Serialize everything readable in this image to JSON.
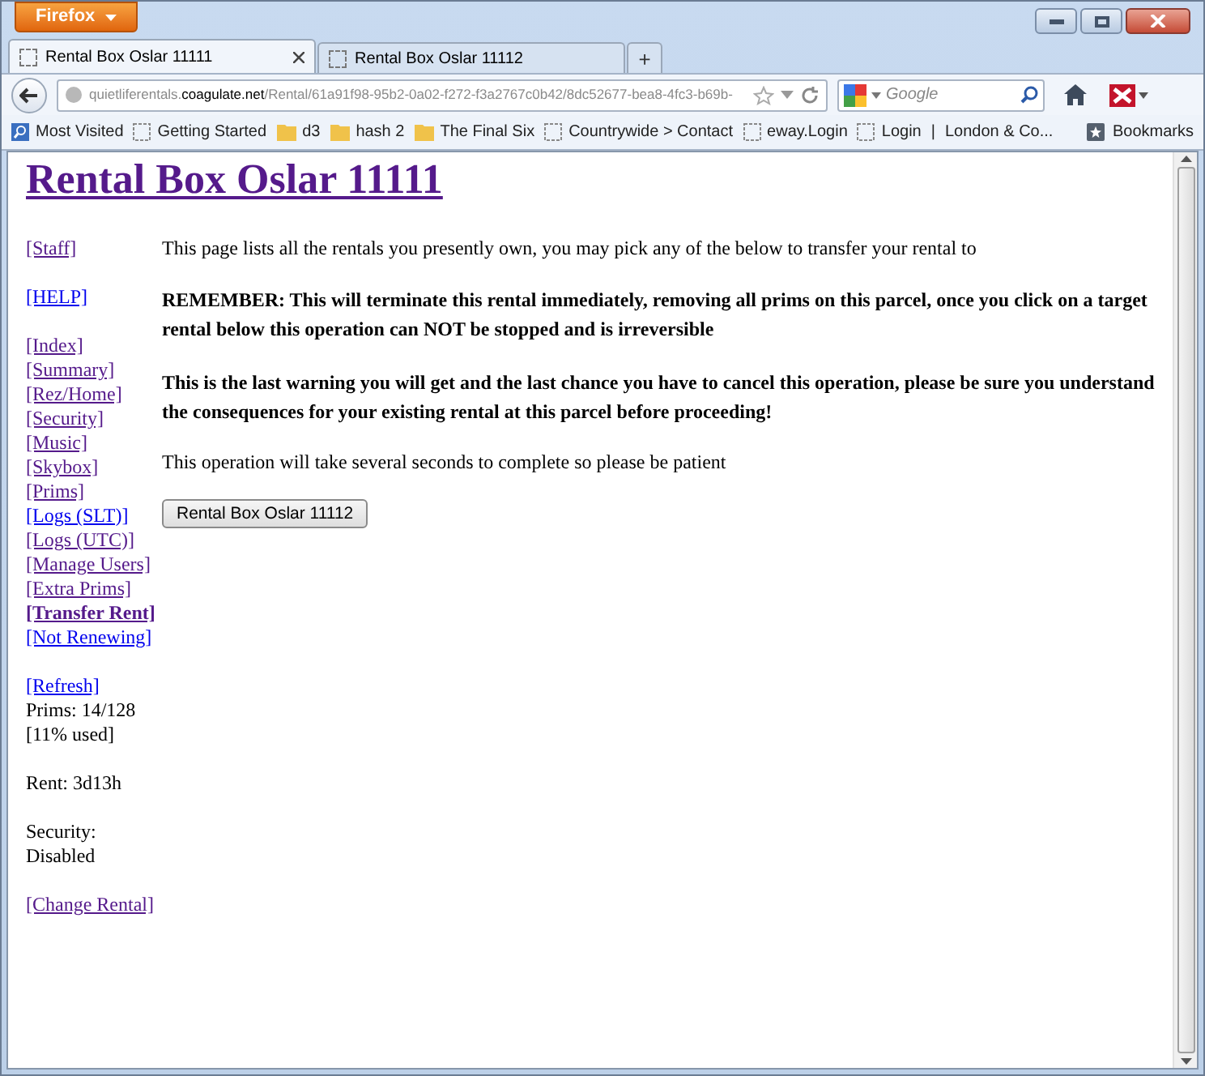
{
  "browser": {
    "menu_button": "Firefox",
    "tabs": [
      {
        "label": "Rental Box Oslar 11111",
        "selected": true
      },
      {
        "label": "Rental Box Oslar 11112",
        "selected": false
      }
    ],
    "new_tab": "+",
    "address": {
      "prefix": "quietliferentals.",
      "domain": "coagulate.net",
      "path": "/Rental/61a91f98-95b2-0a02-f272-f3a2767c0b42/8dc52677-bea8-4fc3-b69b-"
    },
    "search": {
      "placeholder": "Google"
    },
    "bookmarks": [
      {
        "label": "Most Visited",
        "kind": "special"
      },
      {
        "label": "Getting Started",
        "kind": "page"
      },
      {
        "label": "d3",
        "kind": "folder"
      },
      {
        "label": "hash 2",
        "kind": "folder"
      },
      {
        "label": "The Final Six",
        "kind": "folder"
      },
      {
        "label": "Countrywide > Contact",
        "kind": "page"
      },
      {
        "label": "eway.Login",
        "kind": "page"
      },
      {
        "label": "Login",
        "kind": "page"
      },
      {
        "label": "|",
        "kind": "separator"
      },
      {
        "label": "London & Co...",
        "kind": "plain"
      }
    ],
    "bookmarks_menu": "Bookmarks"
  },
  "page": {
    "title": "Rental Box Oslar 11111",
    "sidebar": [
      [
        {
          "label": "[Staff]",
          "kind": "link",
          "visited": true,
          "current": false
        }
      ],
      [
        {
          "label": "[HELP]",
          "kind": "link",
          "visited": false,
          "current": false
        }
      ],
      [
        {
          "label": "[Index]",
          "kind": "link",
          "visited": true,
          "current": false
        },
        {
          "label": "[Summary]",
          "kind": "link",
          "visited": true,
          "current": false
        },
        {
          "label": "[Rez/Home]",
          "kind": "link",
          "visited": true,
          "current": false
        },
        {
          "label": "[Security]",
          "kind": "link",
          "visited": true,
          "current": false
        },
        {
          "label": "[Music]",
          "kind": "link",
          "visited": true,
          "current": false
        },
        {
          "label": "[Skybox]",
          "kind": "link",
          "visited": true,
          "current": false
        },
        {
          "label": "[Prims]",
          "kind": "link",
          "visited": true,
          "current": false
        },
        {
          "label": "[Logs (SLT)]",
          "kind": "link",
          "visited": false,
          "current": false
        },
        {
          "label": "[Logs (UTC)]",
          "kind": "link",
          "visited": true,
          "current": false
        },
        {
          "label": "[Manage Users]",
          "kind": "link",
          "visited": true,
          "current": false
        },
        {
          "label": "[Extra Prims]",
          "kind": "link",
          "visited": true,
          "current": false
        },
        {
          "label": "[Transfer Rent]",
          "kind": "link",
          "visited": true,
          "current": true
        },
        {
          "label": "[Not Renewing]",
          "kind": "link",
          "visited": false,
          "current": false
        }
      ],
      [
        {
          "label": "[Refresh]",
          "kind": "link",
          "visited": false,
          "current": false
        },
        {
          "label": "Prims: 14/128",
          "kind": "text"
        },
        {
          "label": "[11% used]",
          "kind": "text"
        }
      ],
      [
        {
          "label": "Rent: 3d13h",
          "kind": "text"
        }
      ],
      [
        {
          "label": "Security:",
          "kind": "text"
        },
        {
          "label": "Disabled",
          "kind": "text"
        }
      ],
      [
        {
          "label": "[Change Rental]",
          "kind": "link",
          "visited": true,
          "current": false
        }
      ]
    ],
    "paragraphs": [
      {
        "text": "This page lists all the rentals you presently own, you may pick any of the below to transfer your rental to",
        "bold": false
      },
      {
        "text": "REMEMBER: This will terminate this rental immediately, removing all prims on this parcel, once you click on a target rental below this operation can NOT be stopped and is irreversible",
        "bold": true
      },
      {
        "text": "This is the last warning you will get and the last chance you have to cancel this operation, please be sure you understand the consequences for your existing rental at this parcel before proceeding!",
        "bold": true
      },
      {
        "text": "This operation will take several seconds to complete so please be patient",
        "bold": false
      }
    ],
    "buttons": [
      "Rental Box Oslar 11112"
    ]
  }
}
